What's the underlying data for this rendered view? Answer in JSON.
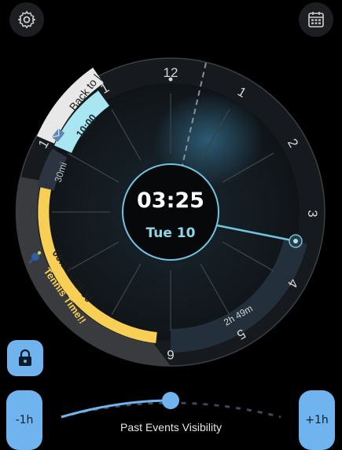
{
  "header": {
    "settings_icon": "gear-icon",
    "calendar_icon": "calendar-grid-icon"
  },
  "clock": {
    "time": "03:25",
    "date": "Tue 10",
    "hour_labels": [
      "12",
      "1",
      "2",
      "3",
      "4",
      "5",
      "6"
    ],
    "outer_small_labels": [
      "1",
      "1"
    ]
  },
  "events": [
    {
      "title": "Back to |",
      "time": "10:00",
      "icon": "mail-icon",
      "color": "#a8e6f2"
    },
    {
      "title": "Tennis Time!!",
      "time": "06:15 - 09:30",
      "icon": "tennis-icon",
      "color": "#f7cf55"
    }
  ],
  "badges": {
    "duration_30": "30mi",
    "remaining": "2h 49m"
  },
  "controls": {
    "lock_icon": "lock-icon",
    "minus_label": "-1h",
    "plus_label": "+1h",
    "slider_label": "Past Events Visibility",
    "slider_value": 0.45
  },
  "colors": {
    "accent": "#6fb4ee",
    "event_yellow": "#f7cf55",
    "event_cyan": "#a8e6f2",
    "hand": "#6fc4e0"
  }
}
